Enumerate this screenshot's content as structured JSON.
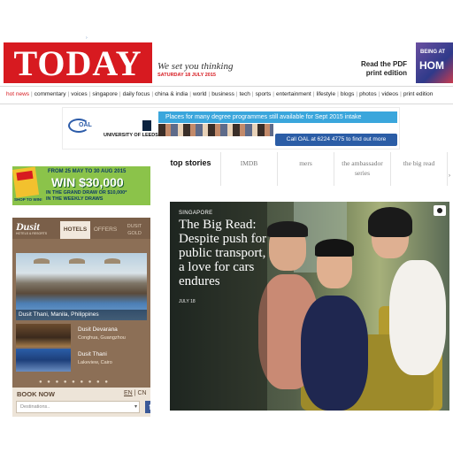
{
  "masthead": {
    "logo": "TODAY",
    "tagline": "We set you thinking",
    "date": "SATURDAY 18 JULY 2015",
    "pdf_link": "Read the PDF print edition",
    "promo_line1": "BEING AT",
    "promo_line2": "HOM"
  },
  "nav": {
    "items": [
      "hot news",
      "commentary",
      "voices",
      "singapore",
      "daily focus",
      "china & india",
      "world",
      "business",
      "tech",
      "sports",
      "entertainment",
      "lifestyle",
      "blogs",
      "photos",
      "videos",
      "print edition"
    ]
  },
  "banner_ad": {
    "brand": "OAL",
    "university": "UNIVERSITY OF LEEDS",
    "headline": "Places for many degree programmes still available for Sept 2015 intake",
    "cta": "Call OAL at 6224 4775 to find out more"
  },
  "win_ad": {
    "line1": "FROM 25 MAY TO 30 AUG 2015",
    "line2": "WIN $30,000",
    "line3": "IN THE GRAND DRAW OR $10,000*",
    "line4": "IN THE WEEKLY DRAWS",
    "line5": "SHOP TO WIN!"
  },
  "dusit": {
    "logo": "Dusit",
    "sub": "HOTELS & RESORTS",
    "tabs": [
      "HOTELS",
      "OFFERS",
      "DUSIT GOLD"
    ],
    "featured_caption": "Dusit Thani, Manila, Philippines",
    "hotels": [
      {
        "name": "Dusit Devarana",
        "place": "Conghua, Guangzhou"
      },
      {
        "name": "Dusit Thani",
        "place": "Lakeview, Cairo"
      }
    ],
    "dots": "● ● ● ● ● ● ● ● ●",
    "book_label": "BOOK NOW",
    "lang_en": "EN",
    "lang_cn": "CN",
    "destination_placeholder": "Destinations..",
    "fb": "f"
  },
  "tabs": [
    {
      "label": "top stories"
    },
    {
      "label": "IMDB"
    },
    {
      "label": "mers"
    },
    {
      "label": "the ambassador series"
    },
    {
      "label": "the big read"
    }
  ],
  "hero": {
    "category": "SINGAPORE",
    "headline": "The Big Read: Despite push for public transport, a love for cars endures",
    "date": "JULY 18"
  }
}
